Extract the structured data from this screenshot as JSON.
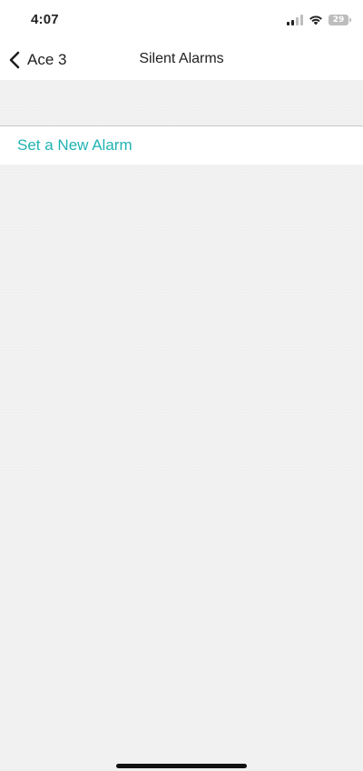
{
  "status_bar": {
    "time": "4:07",
    "battery_level": "29",
    "icons": [
      "signal-icon",
      "wifi-icon",
      "battery-icon"
    ]
  },
  "nav": {
    "back_label": "Ace 3",
    "title": "Silent Alarms",
    "back_icon": "chevron-left-icon"
  },
  "main": {
    "set_alarm_label": "Set a New Alarm"
  },
  "colors": {
    "accent": "#1fb3b3",
    "background": "#f2f2f2"
  }
}
